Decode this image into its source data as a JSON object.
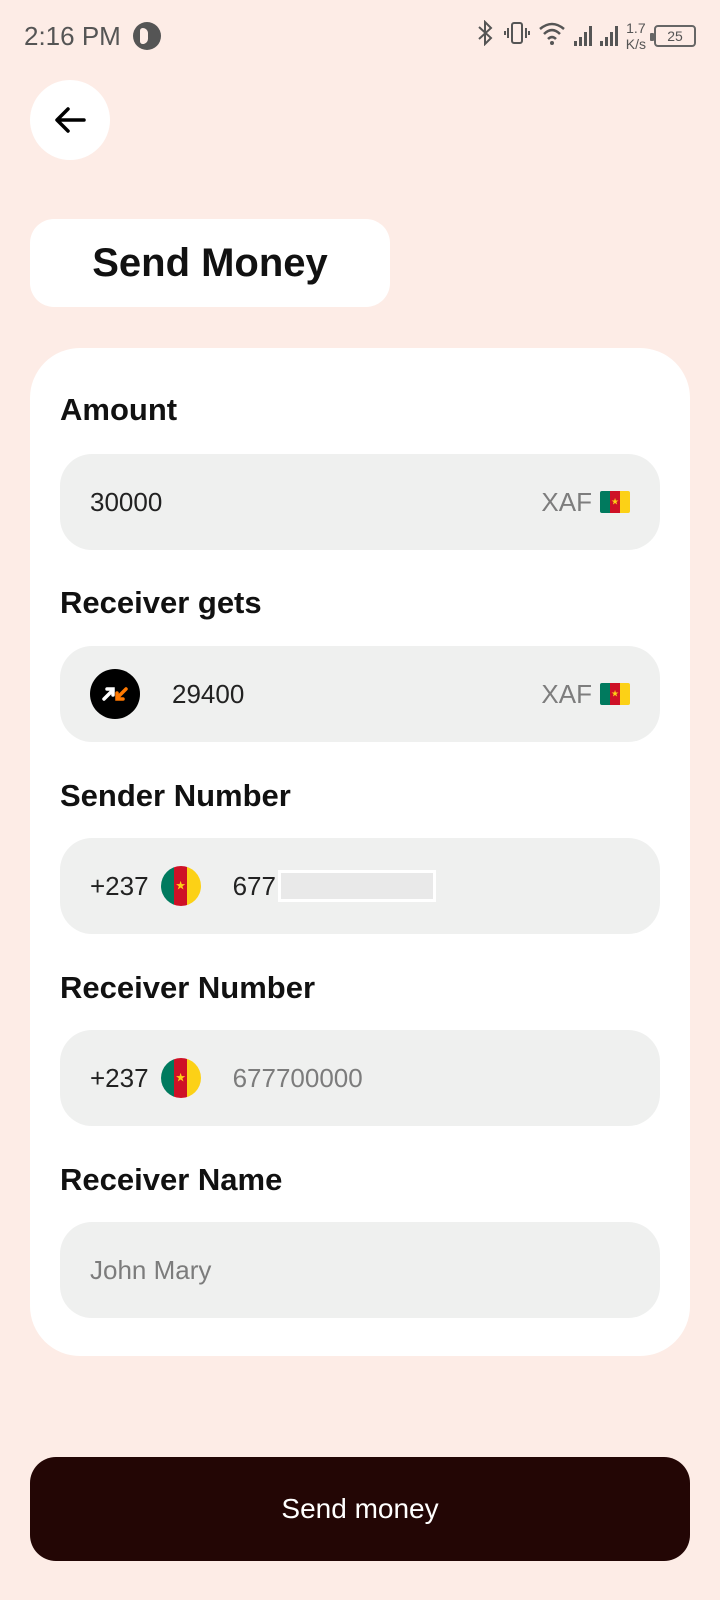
{
  "status_bar": {
    "time": "2:16 PM",
    "net_speed_value": "1.7",
    "net_speed_unit": "K/s",
    "battery": "25"
  },
  "header": {
    "title": "Send Money"
  },
  "form": {
    "amount": {
      "label": "Amount",
      "value": "30000",
      "currency": "XAF"
    },
    "receiver_gets": {
      "label": "Receiver gets",
      "value": "29400",
      "currency": "XAF"
    },
    "sender_number": {
      "label": "Sender Number",
      "country_code": "+237",
      "value": "677"
    },
    "receiver_number": {
      "label": "Receiver Number",
      "country_code": "+237",
      "placeholder": "677700000"
    },
    "receiver_name": {
      "label": "Receiver Name",
      "placeholder": "John Mary"
    }
  },
  "actions": {
    "send_label": "Send money"
  },
  "colors": {
    "background": "#fdece6",
    "card": "#ffffff",
    "field": "#eff0ef",
    "button": "#230605",
    "flag_green": "#007a5e",
    "flag_red": "#ce1126",
    "flag_yellow": "#fcd116",
    "orange_accent": "#ff7900"
  }
}
